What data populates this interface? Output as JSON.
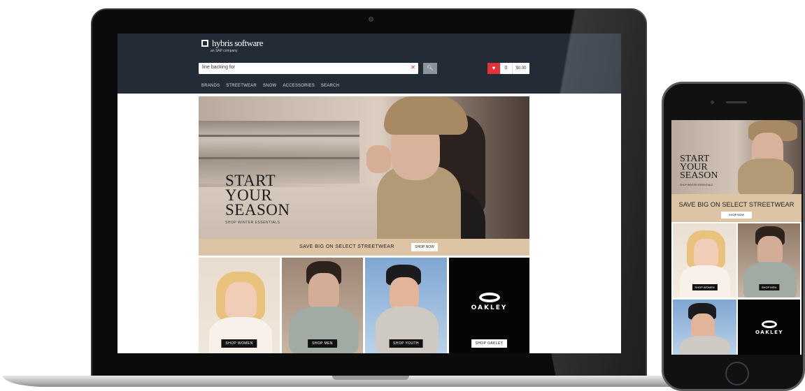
{
  "site": {
    "logo_name": "hybris software",
    "logo_tag": "an SAP company",
    "search_value": "line backing for",
    "nav": [
      "BRANDS",
      "STREETWEAR",
      "SNOW",
      "ACCESSORIES",
      "SEARCH"
    ],
    "cart_count": "0",
    "cart_total": "$0.00"
  },
  "hero": {
    "title_line1": "START",
    "title_line2": "YOUR",
    "title_line3": "SEASON",
    "subtitle": "SHOP WINTER ESSENTIALS"
  },
  "promo": {
    "text": "SAVE BIG ON SELECT STREETWEAR",
    "button": "SHOP NOW"
  },
  "tiles": {
    "women_button": "SHOP WOMEN",
    "men_button": "SHOP MEN",
    "youth_button": "SHOP YOUTH",
    "brand_button": "SHOP OAKLEY",
    "brand_name": "OAKLEY"
  },
  "mobile": {
    "hero_line1": "START",
    "hero_line2": "YOUR",
    "hero_line3": "SEASON",
    "hero_sub": "SHOP WINTER ESSENTIALS",
    "band_text": "SAVE BIG ON SELECT STREETWEAR",
    "band_button": "SHOP NOW",
    "women_button": "SHOP WOMEN",
    "men_button": "SHOP MEN",
    "brand_name": "OAKLEY"
  }
}
